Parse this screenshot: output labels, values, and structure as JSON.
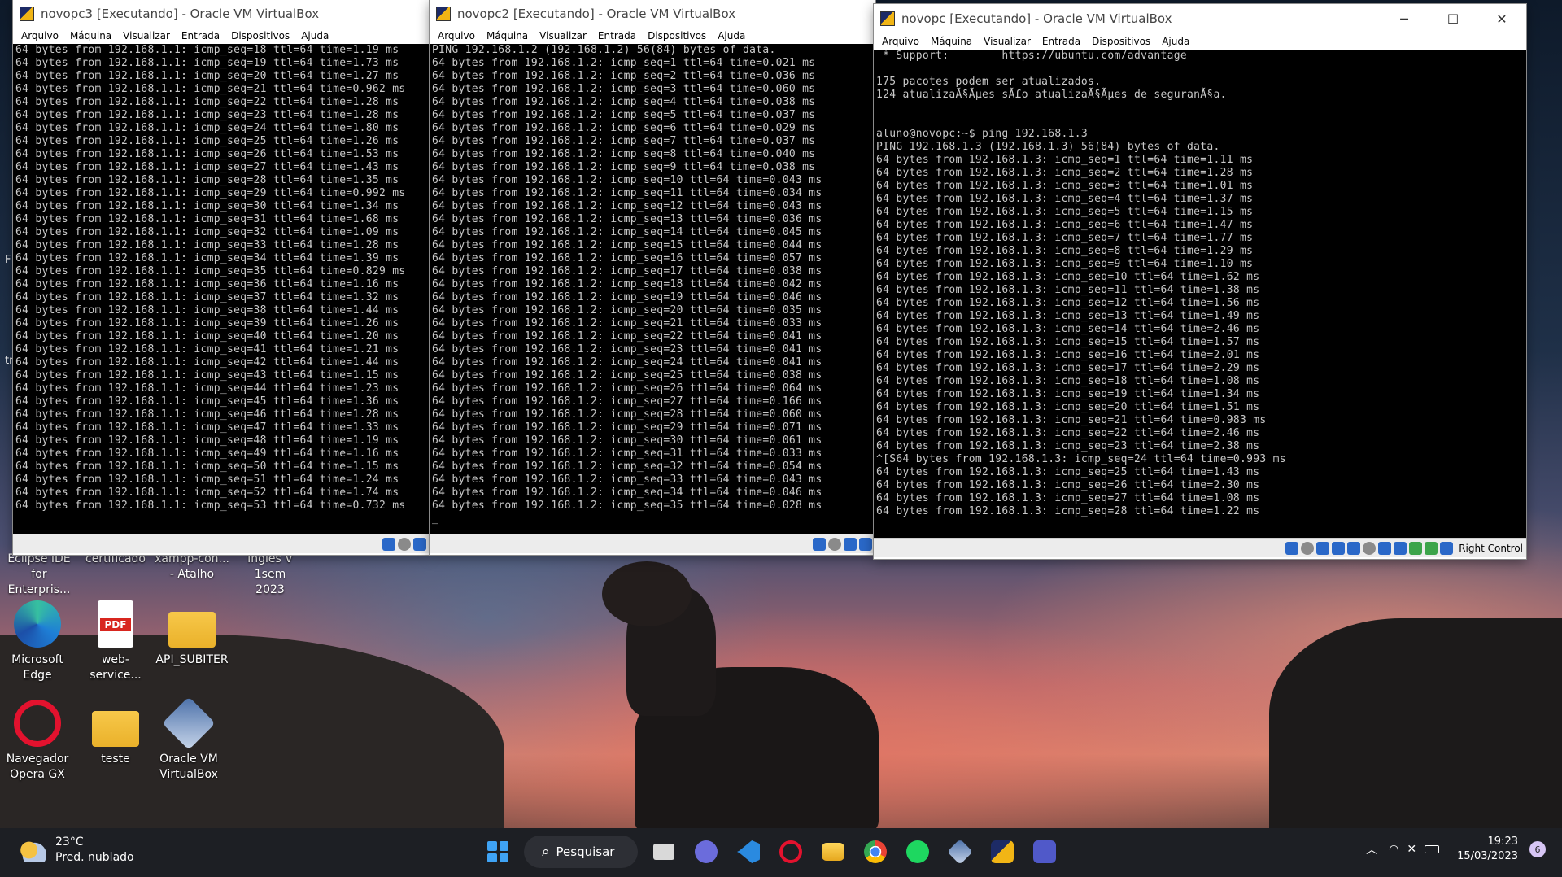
{
  "windows": {
    "vm3": {
      "title": "novopc3 [Executando] - Oracle VM VirtualBox",
      "menu": [
        "Arquivo",
        "Máquina",
        "Visualizar",
        "Entrada",
        "Dispositivos",
        "Ajuda"
      ],
      "terminal": "64 bytes from 192.168.1.1: icmp_seq=18 ttl=64 time=1.19 ms\n64 bytes from 192.168.1.1: icmp_seq=19 ttl=64 time=1.73 ms\n64 bytes from 192.168.1.1: icmp_seq=20 ttl=64 time=1.27 ms\n64 bytes from 192.168.1.1: icmp_seq=21 ttl=64 time=0.962 ms\n64 bytes from 192.168.1.1: icmp_seq=22 ttl=64 time=1.28 ms\n64 bytes from 192.168.1.1: icmp_seq=23 ttl=64 time=1.28 ms\n64 bytes from 192.168.1.1: icmp_seq=24 ttl=64 time=1.80 ms\n64 bytes from 192.168.1.1: icmp_seq=25 ttl=64 time=1.26 ms\n64 bytes from 192.168.1.1: icmp_seq=26 ttl=64 time=1.53 ms\n64 bytes from 192.168.1.1: icmp_seq=27 ttl=64 time=1.43 ms\n64 bytes from 192.168.1.1: icmp_seq=28 ttl=64 time=1.35 ms\n64 bytes from 192.168.1.1: icmp_seq=29 ttl=64 time=0.992 ms\n64 bytes from 192.168.1.1: icmp_seq=30 ttl=64 time=1.34 ms\n64 bytes from 192.168.1.1: icmp_seq=31 ttl=64 time=1.68 ms\n64 bytes from 192.168.1.1: icmp_seq=32 ttl=64 time=1.09 ms\n64 bytes from 192.168.1.1: icmp_seq=33 ttl=64 time=1.28 ms\n64 bytes from 192.168.1.1: icmp_seq=34 ttl=64 time=1.39 ms\n64 bytes from 192.168.1.1: icmp_seq=35 ttl=64 time=0.829 ms\n64 bytes from 192.168.1.1: icmp_seq=36 ttl=64 time=1.16 ms\n64 bytes from 192.168.1.1: icmp_seq=37 ttl=64 time=1.32 ms\n64 bytes from 192.168.1.1: icmp_seq=38 ttl=64 time=1.44 ms\n64 bytes from 192.168.1.1: icmp_seq=39 ttl=64 time=1.26 ms\n64 bytes from 192.168.1.1: icmp_seq=40 ttl=64 time=1.20 ms\n64 bytes from 192.168.1.1: icmp_seq=41 ttl=64 time=1.21 ms\n64 bytes from 192.168.1.1: icmp_seq=42 ttl=64 time=1.44 ms\n64 bytes from 192.168.1.1: icmp_seq=43 ttl=64 time=1.15 ms\n64 bytes from 192.168.1.1: icmp_seq=44 ttl=64 time=1.23 ms\n64 bytes from 192.168.1.1: icmp_seq=45 ttl=64 time=1.36 ms\n64 bytes from 192.168.1.1: icmp_seq=46 ttl=64 time=1.28 ms\n64 bytes from 192.168.1.1: icmp_seq=47 ttl=64 time=1.33 ms\n64 bytes from 192.168.1.1: icmp_seq=48 ttl=64 time=1.19 ms\n64 bytes from 192.168.1.1: icmp_seq=49 ttl=64 time=1.16 ms\n64 bytes from 192.168.1.1: icmp_seq=50 ttl=64 time=1.15 ms\n64 bytes from 192.168.1.1: icmp_seq=51 ttl=64 time=1.24 ms\n64 bytes from 192.168.1.1: icmp_seq=52 ttl=64 time=1.74 ms\n64 bytes from 192.168.1.1: icmp_seq=53 ttl=64 time=0.732 ms"
    },
    "vm2": {
      "title": "novopc2 [Executando] - Oracle VM VirtualBox",
      "menu": [
        "Arquivo",
        "Máquina",
        "Visualizar",
        "Entrada",
        "Dispositivos",
        "Ajuda"
      ],
      "terminal": "PING 192.168.1.2 (192.168.1.2) 56(84) bytes of data.\n64 bytes from 192.168.1.2: icmp_seq=1 ttl=64 time=0.021 ms\n64 bytes from 192.168.1.2: icmp_seq=2 ttl=64 time=0.036 ms\n64 bytes from 192.168.1.2: icmp_seq=3 ttl=64 time=0.060 ms\n64 bytes from 192.168.1.2: icmp_seq=4 ttl=64 time=0.038 ms\n64 bytes from 192.168.1.2: icmp_seq=5 ttl=64 time=0.037 ms\n64 bytes from 192.168.1.2: icmp_seq=6 ttl=64 time=0.029 ms\n64 bytes from 192.168.1.2: icmp_seq=7 ttl=64 time=0.037 ms\n64 bytes from 192.168.1.2: icmp_seq=8 ttl=64 time=0.040 ms\n64 bytes from 192.168.1.2: icmp_seq=9 ttl=64 time=0.038 ms\n64 bytes from 192.168.1.2: icmp_seq=10 ttl=64 time=0.043 ms\n64 bytes from 192.168.1.2: icmp_seq=11 ttl=64 time=0.034 ms\n64 bytes from 192.168.1.2: icmp_seq=12 ttl=64 time=0.043 ms\n64 bytes from 192.168.1.2: icmp_seq=13 ttl=64 time=0.036 ms\n64 bytes from 192.168.1.2: icmp_seq=14 ttl=64 time=0.045 ms\n64 bytes from 192.168.1.2: icmp_seq=15 ttl=64 time=0.044 ms\n64 bytes from 192.168.1.2: icmp_seq=16 ttl=64 time=0.057 ms\n64 bytes from 192.168.1.2: icmp_seq=17 ttl=64 time=0.038 ms\n64 bytes from 192.168.1.2: icmp_seq=18 ttl=64 time=0.042 ms\n64 bytes from 192.168.1.2: icmp_seq=19 ttl=64 time=0.046 ms\n64 bytes from 192.168.1.2: icmp_seq=20 ttl=64 time=0.035 ms\n64 bytes from 192.168.1.2: icmp_seq=21 ttl=64 time=0.033 ms\n64 bytes from 192.168.1.2: icmp_seq=22 ttl=64 time=0.041 ms\n64 bytes from 192.168.1.2: icmp_seq=23 ttl=64 time=0.041 ms\n64 bytes from 192.168.1.2: icmp_seq=24 ttl=64 time=0.041 ms\n64 bytes from 192.168.1.2: icmp_seq=25 ttl=64 time=0.038 ms\n64 bytes from 192.168.1.2: icmp_seq=26 ttl=64 time=0.064 ms\n64 bytes from 192.168.1.2: icmp_seq=27 ttl=64 time=0.166 ms\n64 bytes from 192.168.1.2: icmp_seq=28 ttl=64 time=0.060 ms\n64 bytes from 192.168.1.2: icmp_seq=29 ttl=64 time=0.071 ms\n64 bytes from 192.168.1.2: icmp_seq=30 ttl=64 time=0.061 ms\n64 bytes from 192.168.1.2: icmp_seq=31 ttl=64 time=0.033 ms\n64 bytes from 192.168.1.2: icmp_seq=32 ttl=64 time=0.054 ms\n64 bytes from 192.168.1.2: icmp_seq=33 ttl=64 time=0.043 ms\n64 bytes from 192.168.1.2: icmp_seq=34 ttl=64 time=0.046 ms\n64 bytes from 192.168.1.2: icmp_seq=35 ttl=64 time=0.028 ms\n_"
    },
    "vm1": {
      "title": "novopc [Executando] - Oracle VM VirtualBox",
      "menu": [
        "Arquivo",
        "Máquina",
        "Visualizar",
        "Entrada",
        "Dispositivos",
        "Ajuda"
      ],
      "host_key": "Right Control",
      "win_buttons": [
        "─",
        "☐",
        "✕"
      ],
      "terminal": " * Support:        https://ubuntu.com/advantage\n\n175 pacotes podem ser atualizados.\n124 atualizaÃ§Ãµes sÃ£o atualizaÃ§Ãµes de seguranÃ§a.\n\n\naluno@novopc:~$ ping 192.168.1.3\nPING 192.168.1.3 (192.168.1.3) 56(84) bytes of data.\n64 bytes from 192.168.1.3: icmp_seq=1 ttl=64 time=1.11 ms\n64 bytes from 192.168.1.3: icmp_seq=2 ttl=64 time=1.28 ms\n64 bytes from 192.168.1.3: icmp_seq=3 ttl=64 time=1.01 ms\n64 bytes from 192.168.1.3: icmp_seq=4 ttl=64 time=1.37 ms\n64 bytes from 192.168.1.3: icmp_seq=5 ttl=64 time=1.15 ms\n64 bytes from 192.168.1.3: icmp_seq=6 ttl=64 time=1.47 ms\n64 bytes from 192.168.1.3: icmp_seq=7 ttl=64 time=1.77 ms\n64 bytes from 192.168.1.3: icmp_seq=8 ttl=64 time=1.29 ms\n64 bytes from 192.168.1.3: icmp_seq=9 ttl=64 time=1.10 ms\n64 bytes from 192.168.1.3: icmp_seq=10 ttl=64 time=1.62 ms\n64 bytes from 192.168.1.3: icmp_seq=11 ttl=64 time=1.38 ms\n64 bytes from 192.168.1.3: icmp_seq=12 ttl=64 time=1.56 ms\n64 bytes from 192.168.1.3: icmp_seq=13 ttl=64 time=1.49 ms\n64 bytes from 192.168.1.3: icmp_seq=14 ttl=64 time=2.46 ms\n64 bytes from 192.168.1.3: icmp_seq=15 ttl=64 time=1.57 ms\n64 bytes from 192.168.1.3: icmp_seq=16 ttl=64 time=2.01 ms\n64 bytes from 192.168.1.3: icmp_seq=17 ttl=64 time=2.29 ms\n64 bytes from 192.168.1.3: icmp_seq=18 ttl=64 time=1.08 ms\n64 bytes from 192.168.1.3: icmp_seq=19 ttl=64 time=1.34 ms\n64 bytes from 192.168.1.3: icmp_seq=20 ttl=64 time=1.51 ms\n64 bytes from 192.168.1.3: icmp_seq=21 ttl=64 time=0.983 ms\n64 bytes from 192.168.1.3: icmp_seq=22 ttl=64 time=2.46 ms\n64 bytes from 192.168.1.3: icmp_seq=23 ttl=64 time=2.38 ms\n^[S64 bytes from 192.168.1.3: icmp_seq=24 ttl=64 time=0.993 ms\n64 bytes from 192.168.1.3: icmp_seq=25 ttl=64 time=1.43 ms\n64 bytes from 192.168.1.3: icmp_seq=26 ttl=64 time=2.30 ms\n64 bytes from 192.168.1.3: icmp_seq=27 ttl=64 time=1.08 ms\n64 bytes from 192.168.1.3: icmp_seq=28 ttl=64 time=1.22 ms"
    }
  },
  "desktop": {
    "partial_top": [
      {
        "l1": "Eclipse IDE",
        "l2": "for Enterpris..."
      },
      {
        "l1": "certificado",
        "l2": ""
      },
      {
        "l1": "xampp-con...",
        "l2": "- Atalho"
      },
      {
        "l1": "Inglês V 1sem",
        "l2": "2023"
      }
    ],
    "icons": [
      {
        "l1": "Microsoft",
        "l2": "Edge"
      },
      {
        "l1": "web-service...",
        "l2": ""
      },
      {
        "l1": "API_SUBITER",
        "l2": ""
      },
      {
        "l1": "Navegador",
        "l2": "Opera GX"
      },
      {
        "l1": "teste",
        "l2": ""
      },
      {
        "l1": "Oracle VM",
        "l2": "VirtualBox"
      }
    ],
    "pdf_label": "PDF",
    "edge_fragments": [
      "F",
      "tr"
    ]
  },
  "taskbar": {
    "temp": "23°C",
    "weather": "Pred. nublado",
    "search": "Pesquisar",
    "time": "19:23",
    "date": "15/03/2023",
    "notifications": "6"
  }
}
